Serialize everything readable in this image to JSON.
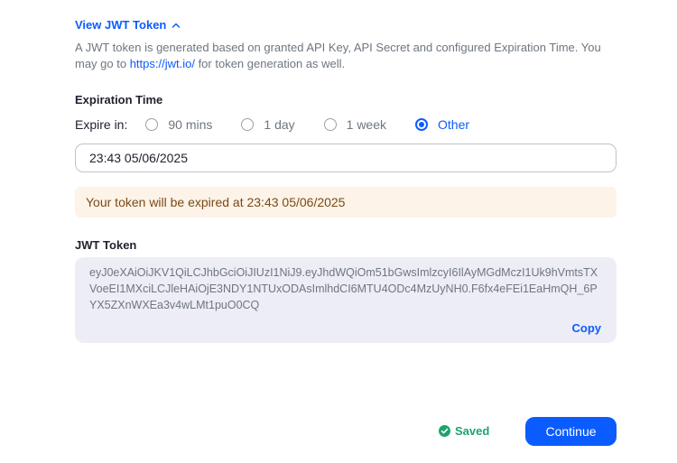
{
  "toggle": {
    "label": "View JWT Token"
  },
  "description": {
    "before": "A JWT token is generated based on granted API Key, API Secret and configured Expiration Time. You may go to ",
    "link": "https://jwt.io/",
    "after": " for token generation as well."
  },
  "expiration": {
    "title": "Expiration Time",
    "expire_label": "Expire in:",
    "options": [
      {
        "label": "90 mins",
        "checked": false
      },
      {
        "label": "1 day",
        "checked": false
      },
      {
        "label": "1 week",
        "checked": false
      },
      {
        "label": "Other",
        "checked": true
      }
    ],
    "input_value": "23:43 05/06/2025",
    "notice": "Your token will be expired at 23:43 05/06/2025"
  },
  "jwt": {
    "title": "JWT Token",
    "token": "eyJ0eXAiOiJKV1QiLCJhbGciOiJIUzI1NiJ9.eyJhdWQiOm51bGwsImlzcyI6IlAyMGdMczI1Uk9hVmtsTXVoeEI1MXciLCJleHAiOjE3NDY1NTUxODAsImlhdCI6MTU4ODc4MzUyNH0.F6fx4eFEi1EaHmQH_6PYX5ZXnWXEa3v4wLMt1puO0CQ",
    "copy_label": "Copy"
  },
  "footer": {
    "saved_label": "Saved",
    "continue_label": "Continue"
  },
  "colors": {
    "accent": "#0b5cff",
    "saved_green": "#20a36e",
    "notice_bg": "#fdf3e8",
    "token_bg": "#ededf5"
  },
  "icons": {
    "toggle": "chevron-up-icon",
    "saved": "check-circle-icon"
  }
}
